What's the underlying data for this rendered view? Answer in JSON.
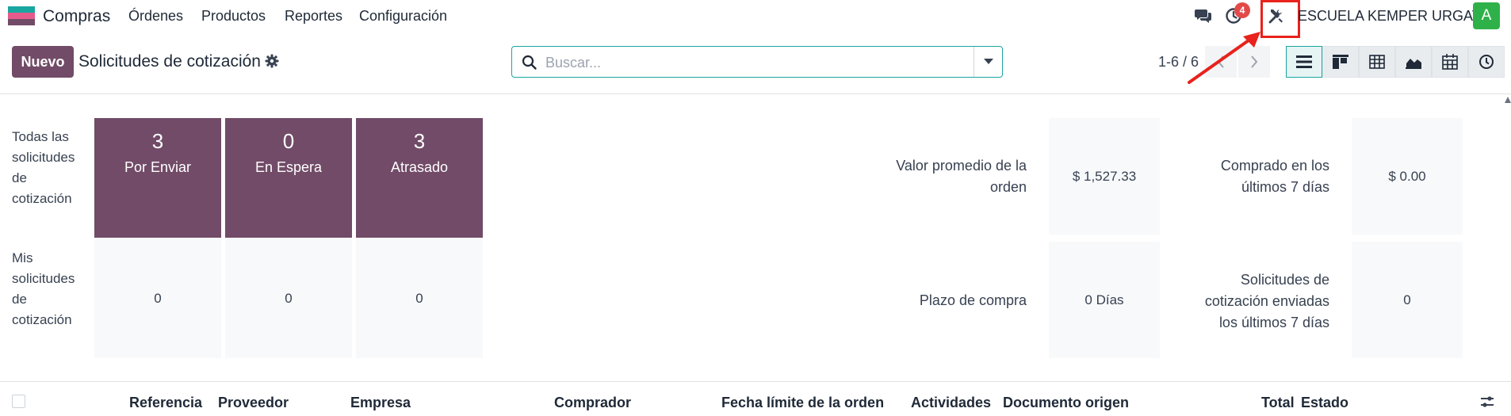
{
  "navbar": {
    "app_name": "Compras",
    "menu": [
      "Órdenes",
      "Productos",
      "Reportes",
      "Configuración"
    ],
    "activity_badge": "4",
    "company": "ESCUELA KEMPER URGATE",
    "avatar_letter": "A"
  },
  "control_panel": {
    "new_button": "Nuevo",
    "title": "Solicitudes de cotización",
    "search_placeholder": "Buscar...",
    "pager": "1-6 / 6"
  },
  "dashboard": {
    "rows": [
      {
        "label": "Todas las solicitudes de cotización",
        "tiles": [
          {
            "value": "3",
            "label": "Por Enviar"
          },
          {
            "value": "0",
            "label": "En Espera"
          },
          {
            "value": "3",
            "label": "Atrasado"
          }
        ]
      },
      {
        "label": "Mis solicitudes de cotización",
        "tiles": [
          {
            "value": "0"
          },
          {
            "value": "0"
          },
          {
            "value": "0"
          }
        ]
      }
    ],
    "kpis": [
      {
        "label": "Valor promedio de la orden",
        "value": "$ 1,527.33"
      },
      {
        "label": "Comprado en los últimos 7 días",
        "value": "$ 0.00"
      },
      {
        "label": "Plazo de compra",
        "value": "0 Días"
      },
      {
        "label": "Solicitudes de cotización enviadas los últimos 7 días",
        "value": "0"
      }
    ]
  },
  "table": {
    "columns": [
      "Referencia",
      "Proveedor",
      "Empresa",
      "Comprador",
      "Fecha límite de la orden",
      "Actividades",
      "Documento origen",
      "Total",
      "Estado"
    ]
  },
  "colors": {
    "brand": "#714b67",
    "accent": "#1aa6a0",
    "highlight": "#e8221c",
    "avatar": "#2fb14a"
  },
  "icons": [
    "chat-icon",
    "clock-icon",
    "tools-icon",
    "gear-icon",
    "search-icon",
    "list-view-icon",
    "kanban-view-icon",
    "pivot-view-icon",
    "graph-view-icon",
    "calendar-view-icon",
    "activity-view-icon"
  ]
}
